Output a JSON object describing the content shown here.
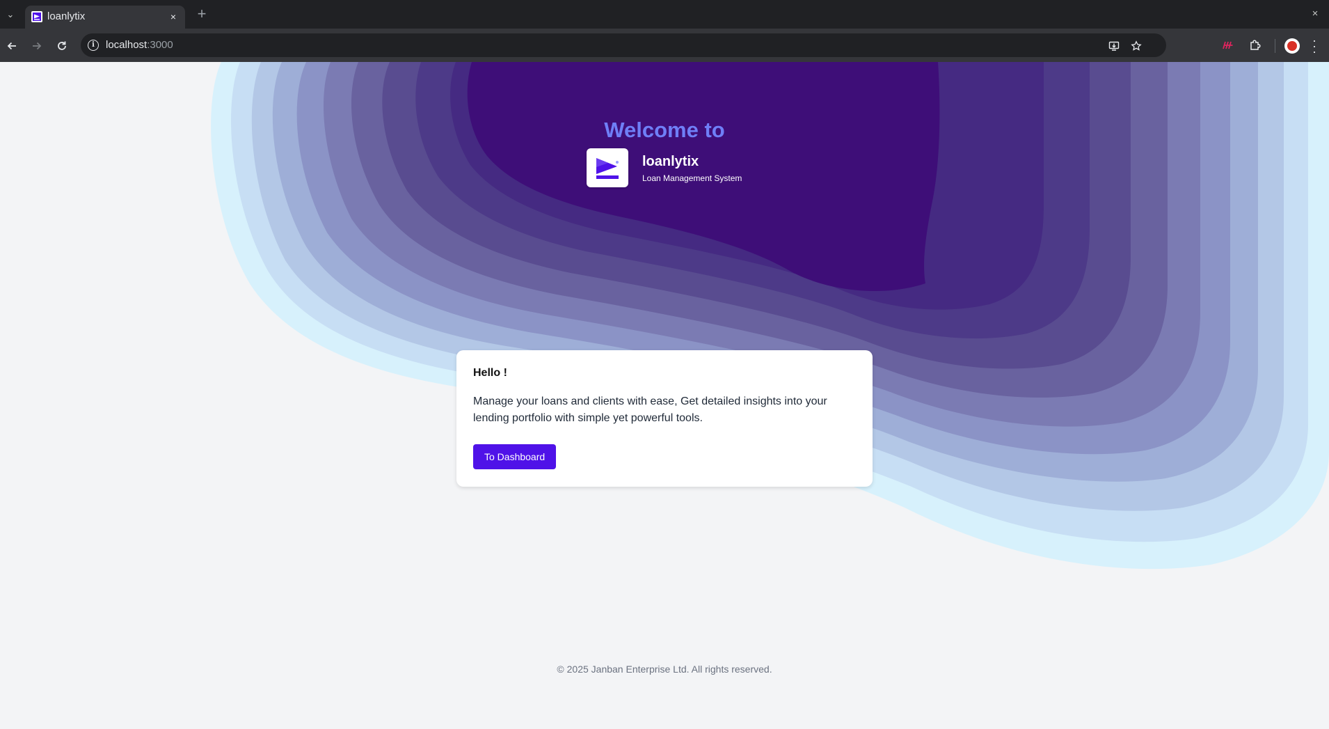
{
  "browser": {
    "tab": {
      "title": "loanlytix",
      "close_glyph": "×"
    },
    "new_tab_glyph": "+",
    "window_close_glyph": "×",
    "tab_list_glyph": "⌄",
    "url": {
      "host": "localhost",
      "port": ":3000"
    },
    "icons": [
      "back-icon",
      "forward-icon",
      "reload-icon",
      "site-info-icon",
      "install-app-icon",
      "bookmark-star-icon",
      "extension-m-icon",
      "extensions-puzzle-icon",
      "profile-avatar",
      "more-menu-icon"
    ]
  },
  "hero": {
    "welcome": "Welcome to",
    "brand_name": "loanlytix",
    "brand_tagline": "Loan Management System"
  },
  "card": {
    "title": "Hello !",
    "body": "Manage your loans and clients with ease, Get detailed insights into your lending portfolio with simple yet powerful tools.",
    "button": "To Dashboard"
  },
  "footer": {
    "copyright": "© 2025 Janban Enterprise Ltd. All rights reserved."
  },
  "colors": {
    "accent_button": "#4f12e8",
    "welcome_text": "#6f7ff7",
    "blob_core": "#3e0e78",
    "blob_outer": "#d7f1fc",
    "page_bg": "#f3f4f6"
  }
}
